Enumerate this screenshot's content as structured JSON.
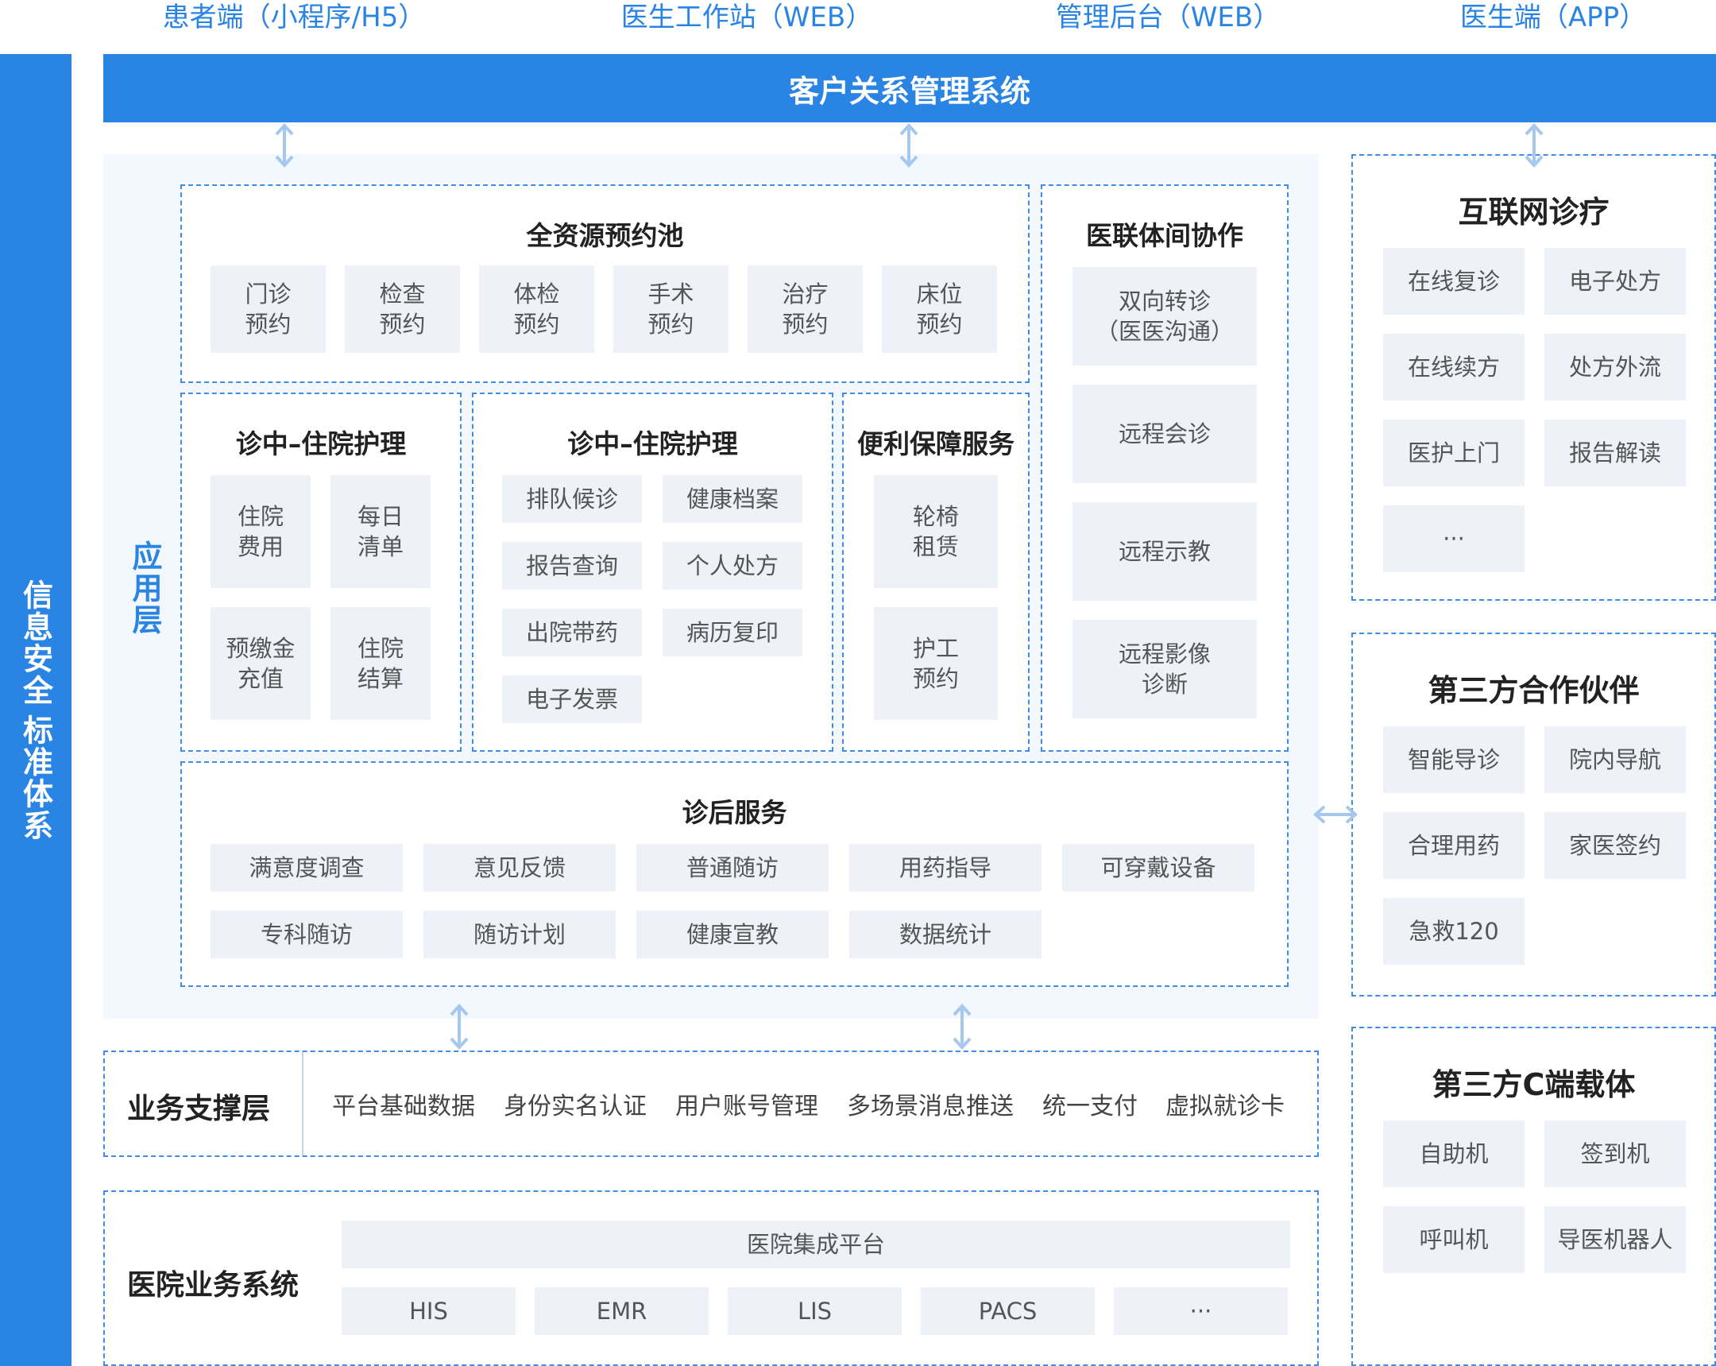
{
  "clients": [
    "患者端（小程序/H5）",
    "医生工作站（WEB）",
    "管理后台（WEB）",
    "医生端（APP）"
  ],
  "left_bar": {
    "security": "信息安全",
    "standard": "标准体系"
  },
  "crm_title": "客户关系管理系统",
  "app_layer_label": "应用层",
  "booking_pool": {
    "title": "全资源预约池",
    "items": [
      "门诊\n预约",
      "检查\n预约",
      "体检\n预约",
      "手术\n预约",
      "治疗\n预约",
      "床位\n预约"
    ]
  },
  "inpatient_left": {
    "title": "诊中–住院护理",
    "items": [
      "住院\n费用",
      "每日\n清单",
      "预缴金\n充值",
      "住院\n结算"
    ]
  },
  "inpatient_mid": {
    "title": "诊中–住院护理",
    "items": [
      "排队候诊",
      "健康档案",
      "报告查询",
      "个人处方",
      "出院带药",
      "病历复印",
      "电子发票"
    ]
  },
  "convenience": {
    "title": "便利保障服务",
    "items": [
      "轮椅\n租赁",
      "护工\n预约"
    ]
  },
  "alliance": {
    "title": "医联体间协作",
    "items": [
      "双向转诊\n（医医沟通）",
      "远程会诊",
      "远程示教",
      "远程影像\n诊断"
    ]
  },
  "after_service": {
    "title": "诊后服务",
    "items": [
      "满意度调查",
      "意见反馈",
      "普通随访",
      "用药指导",
      "可穿戴设备",
      "专科随访",
      "随访计划",
      "健康宣教",
      "数据统计"
    ]
  },
  "internet": {
    "title": "互联网诊疗",
    "items": [
      "在线复诊",
      "电子处方",
      "在线续方",
      "处方外流",
      "医护上门",
      "报告解读",
      "···"
    ]
  },
  "third_party": {
    "title": "第三方合作伙伴",
    "items": [
      "智能导诊",
      "院内导航",
      "合理用药",
      "家医签约",
      "急救120"
    ]
  },
  "c_end": {
    "title": "第三方C端载体",
    "items": [
      "自助机",
      "签到机",
      "呼叫机",
      "导医机器人"
    ]
  },
  "support_layer": {
    "title": "业务支撑层",
    "items": [
      "平台基础数据",
      "身份实名认证",
      "用户账号管理",
      "多场景消息推送",
      "统一支付",
      "虚拟就诊卡"
    ]
  },
  "hospital_system": {
    "title": "医院业务系统",
    "platform": "医院集成平台",
    "items": [
      "HIS",
      "EMR",
      "LIS",
      "PACS",
      "···"
    ]
  },
  "colors": {
    "accent": "#2a84e4",
    "panel": "#f2f8fd",
    "cell": "#eef1f7",
    "arrow": "#a7c8ee"
  }
}
